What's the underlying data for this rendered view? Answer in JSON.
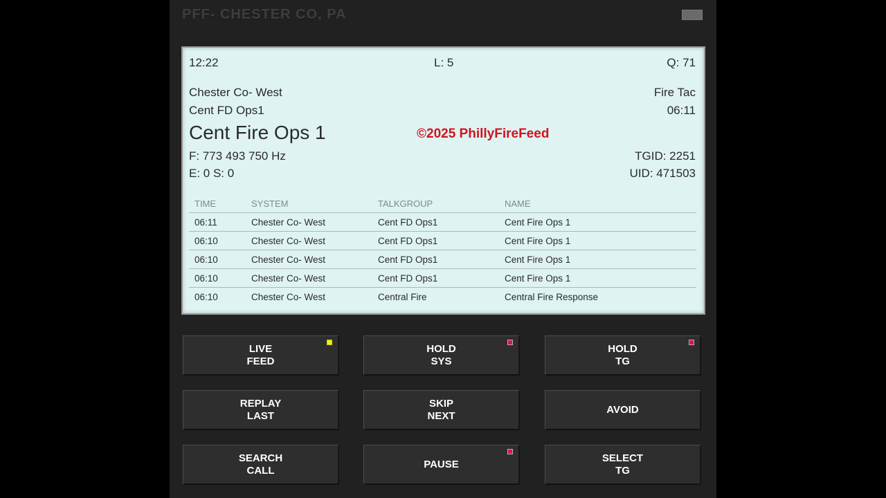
{
  "panel": {
    "title": "PFF- CHESTER CO, PA"
  },
  "display": {
    "clock": "12:22",
    "level": "L: 5",
    "queue": "Q: 71",
    "system": "Chester Co- West",
    "category": "Fire Tac",
    "talkgroup": "Cent FD Ops1",
    "last_time": "06:11",
    "name": "Cent Fire Ops 1",
    "watermark": "©2025 PhillyFireFeed",
    "frequency": "F: 773 493 750 Hz",
    "tgid": "TGID: 2251",
    "errors": "E: 0 S: 0",
    "uid": "UID: 471503"
  },
  "log": {
    "headers": [
      "TIME",
      "SYSTEM",
      "TALKGROUP",
      "NAME"
    ],
    "rows": [
      [
        "06:11",
        "Chester Co- West",
        "Cent FD Ops1",
        "Cent Fire Ops 1"
      ],
      [
        "06:10",
        "Chester Co- West",
        "Cent FD Ops1",
        "Cent Fire Ops 1"
      ],
      [
        "06:10",
        "Chester Co- West",
        "Cent FD Ops1",
        "Cent Fire Ops 1"
      ],
      [
        "06:10",
        "Chester Co- West",
        "Cent FD Ops1",
        "Cent Fire Ops 1"
      ],
      [
        "06:10",
        "Chester Co- West",
        "Central Fire",
        "Central Fire Response"
      ]
    ]
  },
  "buttons": {
    "live_feed": "LIVE\nFEED",
    "hold_sys": "HOLD\nSYS",
    "hold_tg": "HOLD\nTG",
    "replay_last": "REPLAY\nLAST",
    "skip_next": "SKIP\nNEXT",
    "avoid": "AVOID",
    "search_call": "SEARCH\nCALL",
    "pause": "PAUSE",
    "select_tg": "SELECT\nTG"
  },
  "icons": {
    "menu": "menu-icon"
  },
  "colors": {
    "display_bg": "#dff3f3",
    "watermark": "#d0141c",
    "led_active": "#f0f020",
    "led_inactive": "#e0105a"
  }
}
